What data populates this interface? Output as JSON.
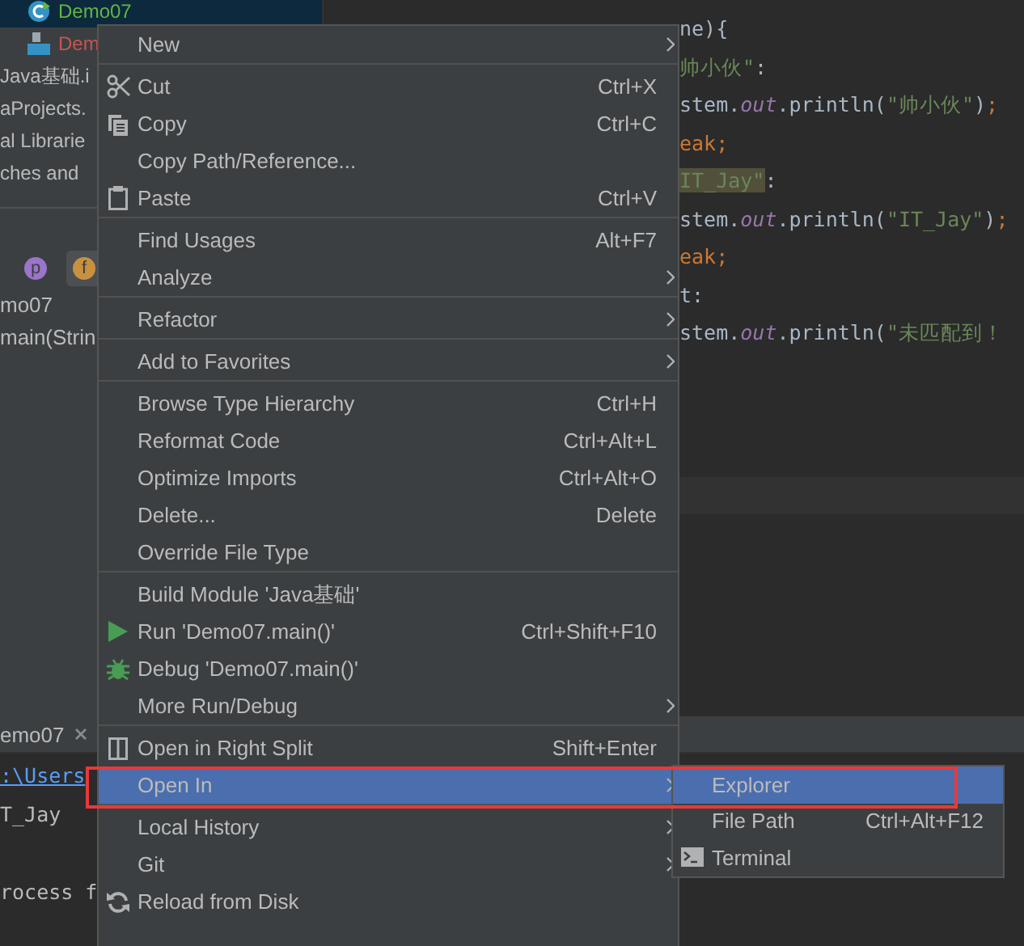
{
  "project_tree": {
    "items": [
      {
        "label": "Demo07",
        "kind": "class",
        "color": "#62b543",
        "selected": true
      },
      {
        "label": "Dem",
        "kind": "binary",
        "color": "#c75450",
        "selected": false
      },
      {
        "label": "Java基础.i",
        "kind": "plain",
        "color": "#bbbbbb",
        "selected": false
      },
      {
        "label": "aProjects.",
        "kind": "plain",
        "color": "#bbbbbb",
        "selected": false
      },
      {
        "label": "al Librarie",
        "kind": "plain",
        "color": "#bbbbbb",
        "selected": false
      },
      {
        "label": "ches and",
        "kind": "plain",
        "color": "#bbbbbb",
        "selected": false
      }
    ]
  },
  "structure": {
    "filters": [
      {
        "label": "p",
        "color": "#9b75c9",
        "on": false
      },
      {
        "label": "f",
        "color": "#c7913f",
        "on": true
      }
    ],
    "items": [
      "mo07",
      "main(Strin"
    ]
  },
  "editor": {
    "lines": [
      [
        {
          "text": "ne){",
          "kind": "plain"
        }
      ],
      [
        {
          "text": "帅小伙\"",
          "kind": "string"
        },
        {
          "text": ":",
          "kind": "plain"
        }
      ],
      [
        {
          "text": "stem.",
          "kind": "plain"
        },
        {
          "text": "out",
          "kind": "field"
        },
        {
          "text": ".println(",
          "kind": "plain"
        },
        {
          "text": "\"帅小伙\"",
          "kind": "string"
        },
        {
          "text": ")",
          "kind": "plain"
        },
        {
          "text": ";",
          "kind": "keyword"
        }
      ],
      [
        {
          "text": "eak;",
          "kind": "keyword"
        }
      ],
      [
        {
          "text": "IT_Jay\"",
          "kind": "string",
          "highlighted": true
        },
        {
          "text": ":",
          "kind": "plain"
        }
      ],
      [
        {
          "text": "stem.",
          "kind": "plain"
        },
        {
          "text": "out",
          "kind": "field"
        },
        {
          "text": ".println(",
          "kind": "plain"
        },
        {
          "text": "\"IT_Jay\"",
          "kind": "string"
        },
        {
          "text": ")",
          "kind": "plain"
        },
        {
          "text": ";",
          "kind": "keyword"
        }
      ],
      [
        {
          "text": "eak;",
          "kind": "keyword"
        }
      ],
      [
        {
          "text": "t:",
          "kind": "plain"
        }
      ],
      [
        {
          "text": "stem.",
          "kind": "plain"
        },
        {
          "text": "out",
          "kind": "field"
        },
        {
          "text": ".println(",
          "kind": "plain"
        },
        {
          "text": "\"未匹配到！",
          "kind": "string"
        }
      ]
    ]
  },
  "run_panel": {
    "tab": "emo07",
    "lines": [
      {
        "text": ":\\Users",
        "kind": "link"
      },
      {
        "text": "T_Jay",
        "kind": "plain"
      },
      {
        "text": "rocess f",
        "kind": "plain"
      }
    ]
  },
  "context_menu": {
    "groups": [
      [
        {
          "label": "New",
          "has_submenu": true,
          "selected": false
        }
      ],
      [
        {
          "label": "Cut",
          "shortcut": "Ctrl+X",
          "has_submenu": false,
          "selected": false
        },
        {
          "label": "Copy",
          "shortcut": "Ctrl+C",
          "has_submenu": false,
          "selected": false
        },
        {
          "label": "Copy Path/Reference...",
          "has_submenu": false,
          "selected": false
        },
        {
          "label": "Paste",
          "shortcut": "Ctrl+V",
          "has_submenu": false,
          "selected": false
        }
      ],
      [
        {
          "label": "Find Usages",
          "shortcut": "Alt+F7",
          "has_submenu": false,
          "selected": false
        },
        {
          "label": "Analyze",
          "has_submenu": true,
          "selected": false
        }
      ],
      [
        {
          "label": "Refactor",
          "has_submenu": true,
          "selected": false
        }
      ],
      [
        {
          "label": "Add to Favorites",
          "has_submenu": true,
          "selected": false
        }
      ],
      [
        {
          "label": "Browse Type Hierarchy",
          "shortcut": "Ctrl+H",
          "has_submenu": false,
          "selected": false
        },
        {
          "label": "Reformat Code",
          "shortcut": "Ctrl+Alt+L",
          "has_submenu": false,
          "selected": false
        },
        {
          "label": "Optimize Imports",
          "shortcut": "Ctrl+Alt+O",
          "has_submenu": false,
          "selected": false
        },
        {
          "label": "Delete...",
          "shortcut": "Delete",
          "has_submenu": false,
          "selected": false
        },
        {
          "label": "Override File Type",
          "has_submenu": false,
          "selected": false
        }
      ],
      [
        {
          "label": "Build Module 'Java基础'",
          "has_submenu": false,
          "selected": false
        },
        {
          "label": "Run 'Demo07.main()'",
          "shortcut": "Ctrl+Shift+F10",
          "has_submenu": false,
          "selected": false
        },
        {
          "label": "Debug 'Demo07.main()'",
          "has_submenu": false,
          "selected": false
        },
        {
          "label": "More Run/Debug",
          "has_submenu": true,
          "selected": false
        }
      ],
      [
        {
          "label": "Open in Right Split",
          "shortcut": "Shift+Enter",
          "has_submenu": false,
          "selected": false
        },
        {
          "label": "Open In",
          "has_submenu": true,
          "selected": true
        }
      ],
      [
        {
          "label": "Local History",
          "has_submenu": true,
          "selected": false
        },
        {
          "label": "Git",
          "has_submenu": true,
          "selected": false
        },
        {
          "label": "Reload from Disk",
          "has_submenu": false,
          "selected": false
        }
      ]
    ]
  },
  "submenu": {
    "items": [
      {
        "label": "Explorer",
        "selected": true
      },
      {
        "label": "File Path",
        "shortcut": "Ctrl+Alt+F12",
        "selected": false
      },
      {
        "label": "Terminal",
        "selected": false
      }
    ]
  }
}
